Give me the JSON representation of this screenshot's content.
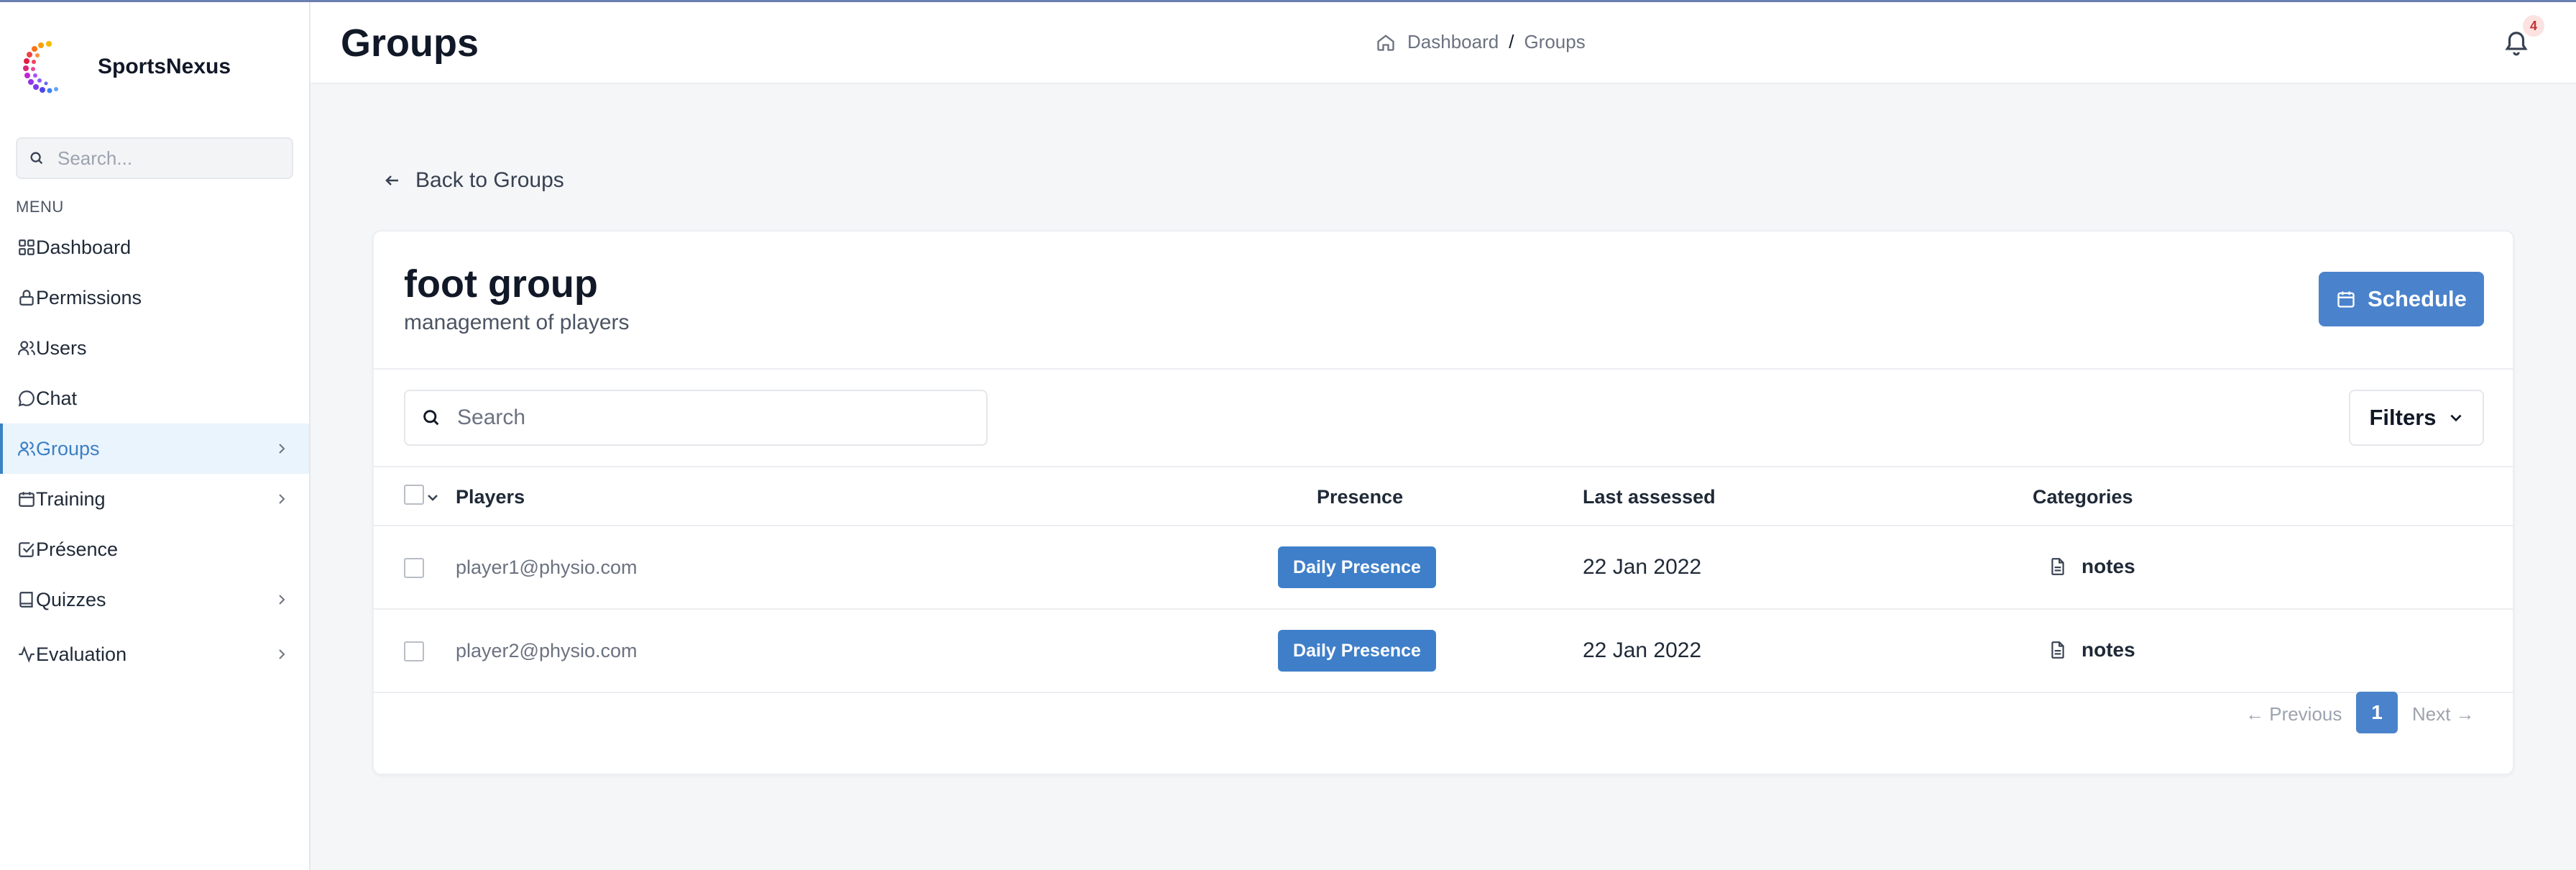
{
  "app": {
    "name": "SportsNexus",
    "logo_icon": "spinner-dots-logo"
  },
  "sidebar": {
    "search_placeholder": "Search...",
    "menu_label": "MENU",
    "items": [
      {
        "label": "Dashboard",
        "icon": "grid-icon",
        "has_submenu": false,
        "active": false
      },
      {
        "label": "Permissions",
        "icon": "lock-icon",
        "has_submenu": false,
        "active": false
      },
      {
        "label": "Users",
        "icon": "users-icon",
        "has_submenu": false,
        "active": false
      },
      {
        "label": "Chat",
        "icon": "chat-bubble-icon",
        "has_submenu": false,
        "active": false
      },
      {
        "label": "Groups",
        "icon": "users-icon",
        "has_submenu": true,
        "active": true
      },
      {
        "label": "Training",
        "icon": "calendar-icon",
        "has_submenu": true,
        "active": false
      },
      {
        "label": "Présence",
        "icon": "check-square-icon",
        "has_submenu": false,
        "active": false
      },
      {
        "label": "Quizzes",
        "icon": "book-icon",
        "has_submenu": true,
        "active": false
      },
      {
        "label": "Evaluation",
        "icon": "activity-icon",
        "has_submenu": true,
        "active": false
      }
    ]
  },
  "header": {
    "title": "Groups",
    "breadcrumb": {
      "home": "Dashboard",
      "separator": "/",
      "current": "Groups"
    },
    "notification_count": "4"
  },
  "main": {
    "back_label": "Back to Groups",
    "group": {
      "name": "foot group",
      "description": "management of players"
    },
    "schedule_label": "Schedule",
    "search_placeholder": "Search",
    "filters_label": "Filters",
    "table": {
      "columns": [
        "Players",
        "Presence",
        "Last assessed",
        "Categories"
      ],
      "rows": [
        {
          "player": "player1@physio.com",
          "presence": "Daily Presence",
          "last_assessed": "22 Jan 2022",
          "categories": "notes"
        },
        {
          "player": "player2@physio.com",
          "presence": "Daily Presence",
          "last_assessed": "22 Jan 2022",
          "categories": "notes"
        }
      ]
    },
    "pagination": {
      "previous": "← Previous",
      "current_page": "1",
      "next": "Next →"
    }
  },
  "colors": {
    "accent": "#4a83cc",
    "active_bg": "#eaf4fd",
    "badge_bg": "#fde2e2",
    "badge_text": "#c53030"
  }
}
